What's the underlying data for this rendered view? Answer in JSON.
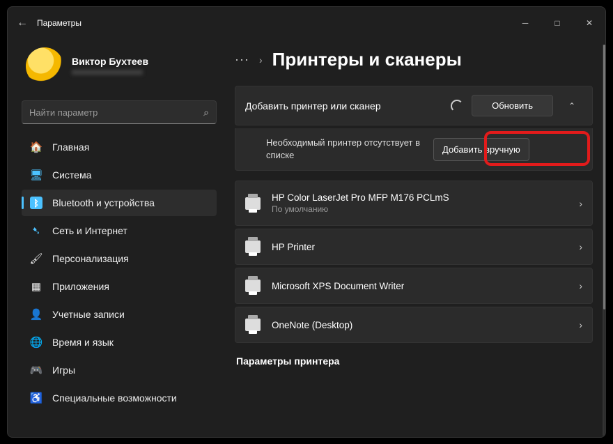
{
  "window": {
    "title": "Параметры"
  },
  "user": {
    "name": "Виктор Бухтеев",
    "email": "xxxxxxxxxxxxxxxxx"
  },
  "search": {
    "placeholder": "Найти параметр"
  },
  "nav": [
    {
      "label": "Главная",
      "icon": "🏠",
      "icon_name": "home-icon"
    },
    {
      "label": "Система",
      "icon": "🖥",
      "icon_name": "system-icon",
      "color": "#4cc2ff"
    },
    {
      "label": "Bluetooth и устройства",
      "icon": "ᛒ",
      "icon_name": "bluetooth-icon",
      "active": true,
      "bg": "#4cc2ff"
    },
    {
      "label": "Сеть и Интернет",
      "icon": "➷",
      "icon_name": "network-icon",
      "color": "#4cc2ff"
    },
    {
      "label": "Персонализация",
      "icon": "🖌",
      "icon_name": "personalization-icon"
    },
    {
      "label": "Приложения",
      "icon": "▦",
      "icon_name": "apps-icon"
    },
    {
      "label": "Учетные записи",
      "icon": "👤",
      "icon_name": "accounts-icon"
    },
    {
      "label": "Время и язык",
      "icon": "🌐",
      "icon_name": "time-language-icon"
    },
    {
      "label": "Игры",
      "icon": "🎮",
      "icon_name": "gaming-icon"
    },
    {
      "label": "Специальные возможности",
      "icon": "♿",
      "icon_name": "accessibility-icon"
    }
  ],
  "breadcrumb": {
    "dots": "···",
    "chevron": "›",
    "title": "Принтеры и сканеры"
  },
  "add": {
    "label": "Добавить принтер или сканер",
    "refresh": "Обновить",
    "caret": "⌃"
  },
  "missing": {
    "text": "Необходимый принтер отсутствует в списке",
    "button": "Добавить вручную"
  },
  "printers": [
    {
      "name": "HP Color LaserJet Pro MFP M176 PCLmS",
      "sub": "По умолчанию"
    },
    {
      "name": "HP Printer",
      "sub": ""
    },
    {
      "name": "Microsoft XPS Document Writer",
      "sub": ""
    },
    {
      "name": "OneNote (Desktop)",
      "sub": ""
    }
  ],
  "section": {
    "params": "Параметры принтера"
  },
  "arrow": "›"
}
